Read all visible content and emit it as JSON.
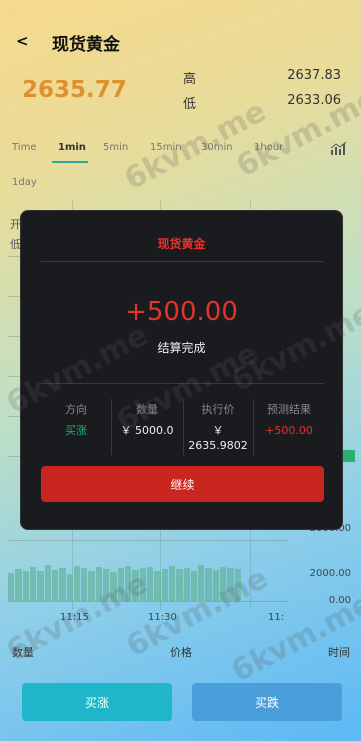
{
  "header": {
    "back_icon": "<",
    "title": "现货黄金"
  },
  "quote": {
    "price": "2635.77",
    "high_label": "高",
    "high_value": "2637.83",
    "low_label": "低",
    "low_value": "2633.06"
  },
  "tabs": [
    "Time",
    "1min",
    "5min",
    "15min",
    "30min",
    "1hour",
    "1day"
  ],
  "active_tab": "1min",
  "chart": {
    "left_fragments": [
      "开",
      "低"
    ],
    "right_axis": [
      "2000.00",
      "0.00"
    ],
    "right_axis_partial": "2000.00",
    "x_ticks": [
      "11:15",
      "11:30",
      "11:"
    ],
    "volume_bars": [
      0.75,
      0.85,
      0.8,
      0.9,
      0.78,
      0.95,
      0.82,
      0.88,
      0.7,
      0.92,
      0.86,
      0.8,
      0.9,
      0.84,
      0.76,
      0.88,
      0.93,
      0.81,
      0.87,
      0.9,
      0.79,
      0.85,
      0.91,
      0.83,
      0.88,
      0.8,
      0.94,
      0.86,
      0.82,
      0.9,
      0.87,
      0.85
    ]
  },
  "footer": {
    "volume_label": "数量",
    "price_label": "价格",
    "time_label": "时间"
  },
  "buttons": {
    "buy_up": "买涨",
    "buy_down": "买跌"
  },
  "modal": {
    "title": "现货黄金",
    "result_amount": "+500.00",
    "status": "结算完成",
    "columns": [
      {
        "head": "方向",
        "value": "买涨"
      },
      {
        "head": "数量",
        "value": "￥ 5000.0"
      },
      {
        "head": "执行价",
        "value": "￥\n2635.9802"
      },
      {
        "head": "预测结果",
        "value": "+500.00"
      }
    ],
    "continue_label": "继续"
  },
  "watermark": "6kvm.me",
  "colors": {
    "accent_red": "#e0342c",
    "price_orange": "#e0902e",
    "green": "#2ab06f",
    "button_red": "#c8261e"
  }
}
